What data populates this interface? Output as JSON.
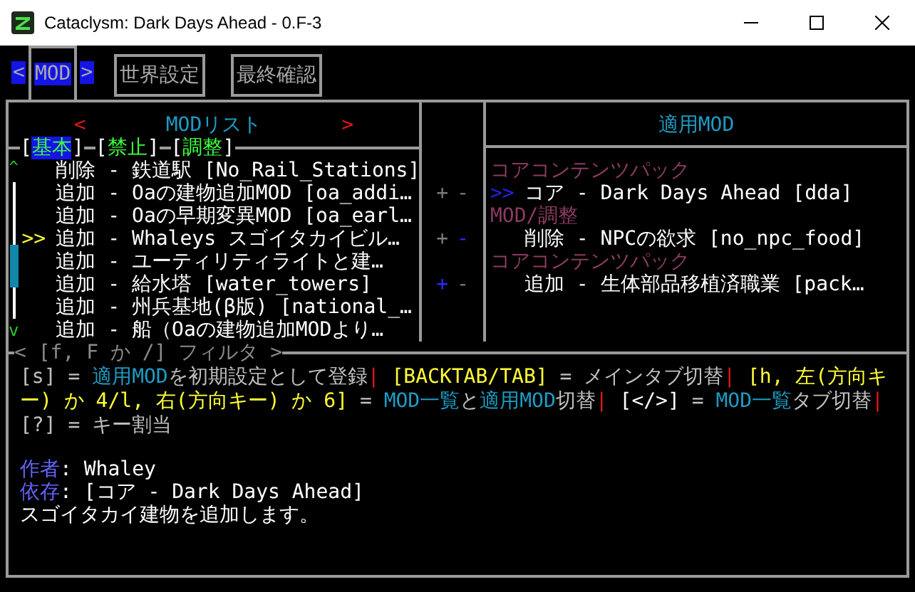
{
  "window": {
    "title": "Cataclysm: Dark Days Ahead - 0.F-3"
  },
  "tab_bar": {
    "prev": "<",
    "next": ">",
    "tabs": [
      {
        "label": "MOD",
        "selected": true
      },
      {
        "label": "世界設定",
        "selected": false
      },
      {
        "label": "最終確認",
        "selected": false
      }
    ]
  },
  "mod_list": {
    "header": {
      "prev": "<",
      "title": "MODリスト",
      "next": ">"
    },
    "bracket_open": "[",
    "bracket_close": "]",
    "category_tabs": [
      {
        "label": "基本",
        "selected": true
      },
      {
        "label": "禁止",
        "selected": false
      },
      {
        "label": "調整",
        "selected": false
      }
    ],
    "scroll_up": "^",
    "scroll_down": "v",
    "cursor": ">>",
    "rows": [
      {
        "text": "削除 - 鉄道駅 [No_Rail_Stations]",
        "selected": false
      },
      {
        "text": "追加 - Oaの建物追加MOD [oa_addi…",
        "selected": false
      },
      {
        "text": "追加 - Oaの早期変異MOD [oa_earl…",
        "selected": false
      },
      {
        "text": "追加 - Whaleys スゴイタカイビル…",
        "selected": true
      },
      {
        "text": "追加 - ユーティリティライトと建…",
        "selected": false
      },
      {
        "text": "追加 - 給水塔 [water_towers]",
        "selected": false
      },
      {
        "text": "追加 - 州兵基地(β版) [national_…",
        "selected": false
      },
      {
        "text": "追加 - 船（Oaの建物追加MODより…",
        "selected": false
      }
    ],
    "filter_hint": "< [f, F か /] フィルタ >"
  },
  "active_mods": {
    "title": "適用MOD",
    "cursor": ">>",
    "rows": [
      {
        "kind": "category",
        "text": "コアコンテンツパック"
      },
      {
        "kind": "mod",
        "text": "コア - Dark Days Ahead [dda]",
        "selected": true,
        "markers": [
          {
            "text": "+",
            "highlighted": false
          },
          {
            "text": "-",
            "highlighted": false
          }
        ]
      },
      {
        "kind": "category",
        "text": "MOD/調整"
      },
      {
        "kind": "mod",
        "text": "削除 - NPCの欲求 [no_npc_food]",
        "selected": false,
        "markers": [
          {
            "text": "+",
            "highlighted": false
          },
          {
            "text": "-",
            "highlighted": true
          }
        ]
      },
      {
        "kind": "category",
        "text": "コアコンテンツパック"
      },
      {
        "kind": "mod",
        "text": "追加 - 生体部品移植済職業 [pack…",
        "selected": false,
        "markers": [
          {
            "text": "+",
            "highlighted": true
          },
          {
            "text": "-",
            "highlighted": false
          }
        ]
      }
    ]
  },
  "help": [
    {
      "kind": "plain",
      "text": "[s] = "
    },
    {
      "kind": "term",
      "text": "適用MOD"
    },
    {
      "kind": "plain",
      "text": "を初期設定として登録"
    },
    {
      "kind": "sep",
      "text": "| "
    },
    {
      "kind": "key",
      "text": "[BACKTAB/TAB]"
    },
    {
      "kind": "plain",
      "text": " = メインタブ切替"
    },
    {
      "kind": "sep",
      "text": "| "
    },
    {
      "kind": "key",
      "text": "[h, 左(方向キー) か 4/l, 右(方向キー) か 6]"
    },
    {
      "kind": "plain",
      "text": " = "
    },
    {
      "kind": "term",
      "text": "MOD一覧"
    },
    {
      "kind": "plain",
      "text": "と"
    },
    {
      "kind": "term",
      "text": "適用MOD"
    },
    {
      "kind": "plain",
      "text": "切替"
    },
    {
      "kind": "sep",
      "text": "| "
    },
    {
      "kind": "bright",
      "text": "[</>]"
    },
    {
      "kind": "plain",
      "text": " = "
    },
    {
      "kind": "term",
      "text": "MOD一覧"
    },
    {
      "kind": "plain",
      "text": "タブ切替"
    },
    {
      "kind": "sep",
      "text": "|"
    },
    {
      "kind": "plain",
      "text": " [?] = キー割当"
    }
  ],
  "details": {
    "fields": [
      {
        "label": "作者",
        "value": ": Whaley"
      },
      {
        "label": "依存",
        "value": ": [コア - Dark Days Ahead]"
      }
    ],
    "description": "スゴイタカイ建物を追加します。"
  }
}
